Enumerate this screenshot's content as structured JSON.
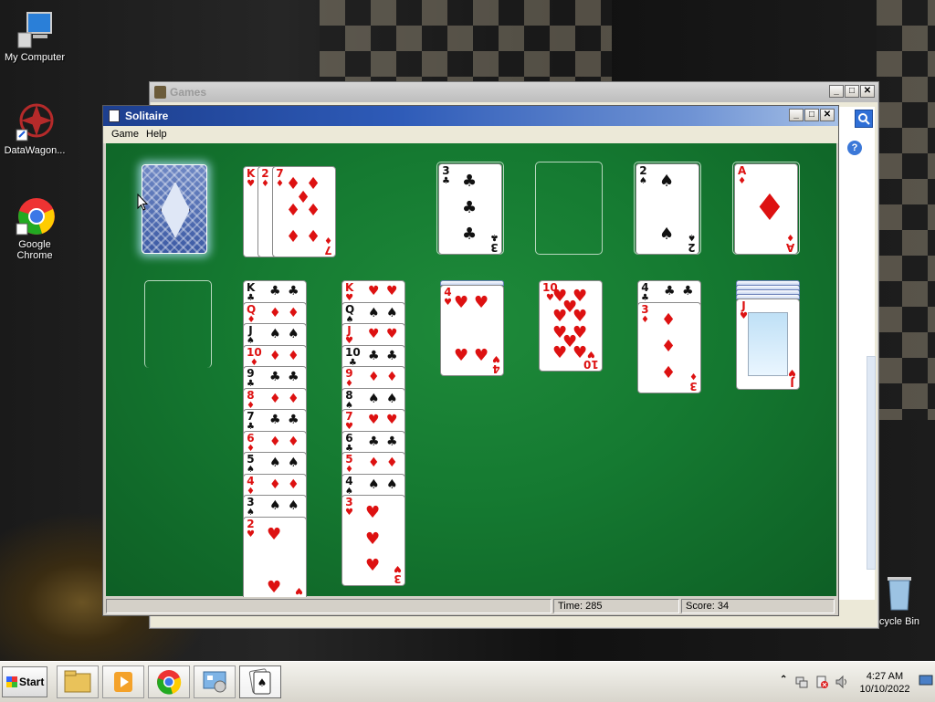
{
  "desktop": {
    "icons": [
      {
        "label": "My Computer"
      },
      {
        "label": "DataWagon..."
      },
      {
        "label": "Google Chrome"
      },
      {
        "label": "cycle Bin"
      }
    ]
  },
  "games_window": {
    "title": "Games",
    "buttons": {
      "minimize": "_",
      "maximize": "□",
      "close": "✕"
    }
  },
  "solitaire": {
    "title": "Solitaire",
    "buttons": {
      "minimize": "_",
      "maximize": "□",
      "close": "✕"
    },
    "menu": [
      "Game",
      "Help"
    ],
    "status": {
      "time_label": "Time:  285",
      "score_label": "Score: 34"
    },
    "stock": {
      "state": "face-down"
    },
    "waste": [
      {
        "rank": "K",
        "suit": "♥",
        "color": "red"
      },
      {
        "rank": "2",
        "suit": "♦",
        "color": "red"
      },
      {
        "rank": "7",
        "suit": "♦",
        "color": "red"
      }
    ],
    "foundations": [
      {
        "rank": "3",
        "suit": "♣",
        "color": "black"
      },
      {
        "rank": "",
        "suit": "",
        "color": "empty"
      },
      {
        "rank": "2",
        "suit": "♠",
        "color": "black"
      },
      {
        "rank": "A",
        "suit": "♦",
        "color": "red"
      }
    ],
    "tableau": [
      {
        "hidden": 0,
        "cards": []
      },
      {
        "hidden": 0,
        "cards": [
          {
            "rank": "K",
            "suit": "♣",
            "color": "black"
          },
          {
            "rank": "Q",
            "suit": "♦",
            "color": "red"
          },
          {
            "rank": "J",
            "suit": "♠",
            "color": "black"
          },
          {
            "rank": "10",
            "suit": "♦",
            "color": "red"
          },
          {
            "rank": "9",
            "suit": "♣",
            "color": "black"
          },
          {
            "rank": "8",
            "suit": "♦",
            "color": "red"
          },
          {
            "rank": "7",
            "suit": "♣",
            "color": "black"
          },
          {
            "rank": "6",
            "suit": "♦",
            "color": "red"
          },
          {
            "rank": "5",
            "suit": "♠",
            "color": "black"
          },
          {
            "rank": "4",
            "suit": "♦",
            "color": "red"
          },
          {
            "rank": "3",
            "suit": "♠",
            "color": "black"
          },
          {
            "rank": "2",
            "suit": "♥",
            "color": "red"
          }
        ]
      },
      {
        "hidden": 0,
        "cards": [
          {
            "rank": "K",
            "suit": "♥",
            "color": "red"
          },
          {
            "rank": "Q",
            "suit": "♠",
            "color": "black"
          },
          {
            "rank": "J",
            "suit": "♥",
            "color": "red"
          },
          {
            "rank": "10",
            "suit": "♣",
            "color": "black"
          },
          {
            "rank": "9",
            "suit": "♦",
            "color": "red"
          },
          {
            "rank": "8",
            "suit": "♠",
            "color": "black"
          },
          {
            "rank": "7",
            "suit": "♥",
            "color": "red"
          },
          {
            "rank": "6",
            "suit": "♣",
            "color": "black"
          },
          {
            "rank": "5",
            "suit": "♦",
            "color": "red"
          },
          {
            "rank": "4",
            "suit": "♠",
            "color": "black"
          },
          {
            "rank": "3",
            "suit": "♥",
            "color": "red"
          }
        ]
      },
      {
        "hidden": 1,
        "cards": [
          {
            "rank": "4",
            "suit": "♥",
            "color": "red"
          }
        ]
      },
      {
        "hidden": 0,
        "cards": [
          {
            "rank": "10",
            "suit": "♥",
            "color": "red"
          }
        ]
      },
      {
        "hidden": 0,
        "cards": [
          {
            "rank": "4",
            "suit": "♣",
            "color": "black"
          },
          {
            "rank": "3",
            "suit": "♦",
            "color": "red"
          }
        ]
      },
      {
        "hidden": 4,
        "cards": [
          {
            "rank": "J",
            "suit": "♥",
            "color": "red"
          }
        ]
      }
    ]
  },
  "taskbar": {
    "start_label": "Start",
    "apps": [
      "file-explorer-icon",
      "media-player-icon",
      "chrome-icon",
      "control-panel-icon",
      "solitaire-icon"
    ],
    "clock_time": "4:27 AM",
    "clock_date": "10/10/2022"
  },
  "colors": {
    "felt": "#157a31",
    "title_bar": "#2e5bb8",
    "red_suit": "#d11111"
  }
}
